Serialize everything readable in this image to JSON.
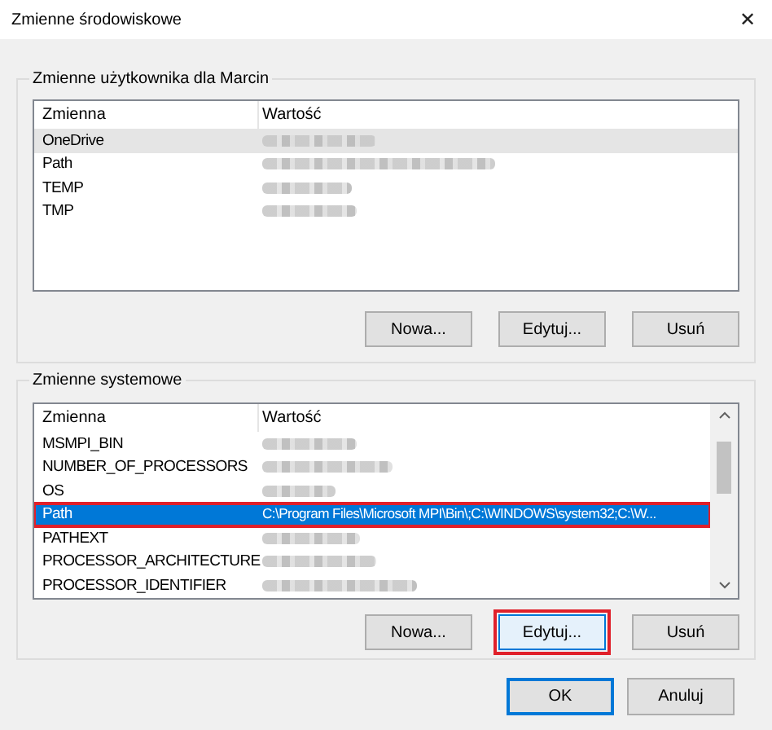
{
  "window": {
    "title": "Zmienne środowiskowe",
    "close": "✕"
  },
  "user_group": {
    "title": "Zmienne użytkownika dla Marcin",
    "columns": [
      "Zmienna",
      "Wartość"
    ],
    "rows": [
      {
        "name": "OneDrive",
        "kind": "blurred",
        "selected": false,
        "hovered": true,
        "highlighted": false
      },
      {
        "name": "Path",
        "kind": "blurred",
        "selected": false,
        "hovered": false,
        "highlighted": false
      },
      {
        "name": "TEMP",
        "kind": "blurred",
        "selected": false,
        "hovered": false,
        "highlighted": false
      },
      {
        "name": "TMP",
        "kind": "blurred",
        "selected": false,
        "hovered": false,
        "highlighted": false
      }
    ],
    "buttons": [
      {
        "label": "Nowa...",
        "highlighted": false
      },
      {
        "label": "Edytuj...",
        "highlighted": false
      },
      {
        "label": "Usuń",
        "highlighted": false
      }
    ]
  },
  "system_group": {
    "title": "Zmienne systemowe",
    "columns": [
      "Zmienna",
      "Wartość"
    ],
    "rows": [
      {
        "name": "MSMPI_BIN",
        "kind": "blurred",
        "selected": false,
        "hovered": false,
        "highlighted": false
      },
      {
        "name": "NUMBER_OF_PROCESSORS",
        "kind": "blurred",
        "selected": false,
        "hovered": false,
        "highlighted": false
      },
      {
        "name": "OS",
        "kind": "blurred",
        "selected": false,
        "hovered": false,
        "highlighted": false
      },
      {
        "name": "Path",
        "kind": "text",
        "value": "C:\\Program Files\\Microsoft MPI\\Bin\\;C:\\WINDOWS\\system32;C:\\W...",
        "selected": true,
        "hovered": false,
        "highlighted": true
      },
      {
        "name": "PATHEXT",
        "kind": "blurred",
        "selected": false,
        "hovered": false,
        "highlighted": false
      },
      {
        "name": "PROCESSOR_ARCHITECTURE",
        "kind": "blurred",
        "selected": false,
        "hovered": false,
        "highlighted": false
      },
      {
        "name": "PROCESSOR_IDENTIFIER",
        "kind": "blurred",
        "selected": false,
        "hovered": false,
        "highlighted": false
      }
    ],
    "buttons": [
      {
        "label": "Nowa...",
        "highlighted": false
      },
      {
        "label": "Edytuj...",
        "highlighted": true
      },
      {
        "label": "Usuń",
        "highlighted": false
      }
    ]
  },
  "footer_buttons": [
    {
      "label": "OK",
      "default": true
    },
    {
      "label": "Anuluj",
      "default": false
    }
  ]
}
